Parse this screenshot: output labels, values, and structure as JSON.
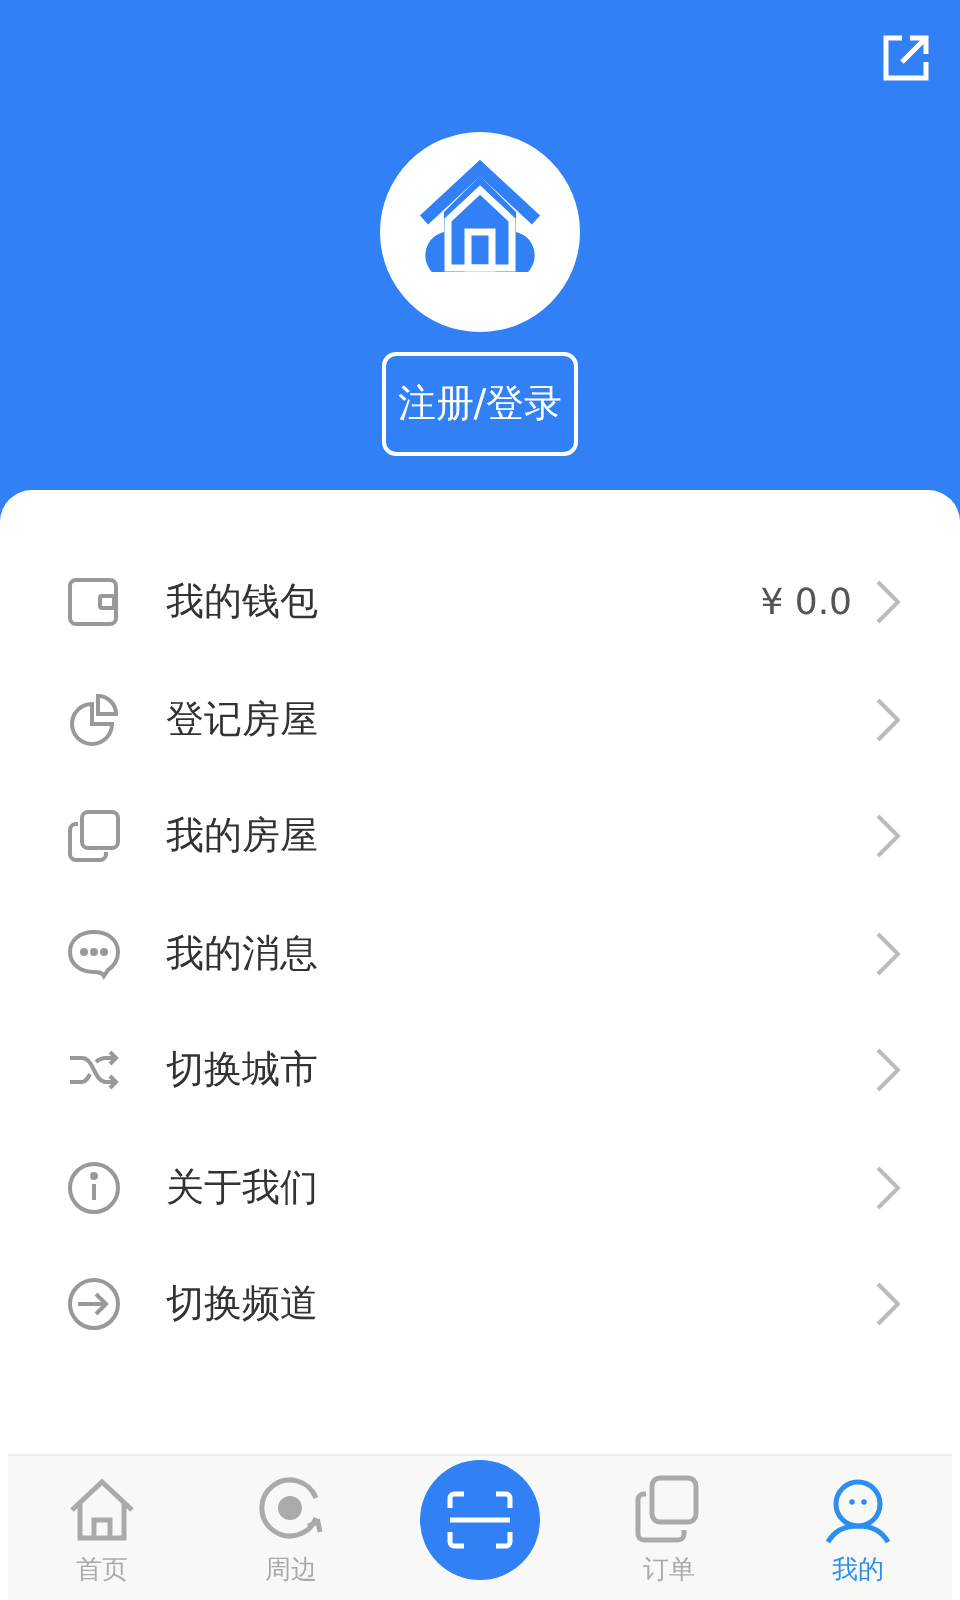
{
  "header": {
    "login_button": "注册/登录"
  },
  "menu": [
    {
      "kind": "wallet",
      "label": "我的钱包",
      "value": "¥ 0.0"
    },
    {
      "kind": "pie",
      "label": "登记房屋"
    },
    {
      "kind": "copy",
      "label": "我的房屋"
    },
    {
      "kind": "chat",
      "label": "我的消息"
    },
    {
      "kind": "shuffle",
      "label": "切换城市"
    },
    {
      "kind": "info",
      "label": "关于我们"
    },
    {
      "kind": "enter",
      "label": "切换频道"
    }
  ],
  "tabs": [
    {
      "kind": "home",
      "label": "首页",
      "selected": false
    },
    {
      "kind": "nearby",
      "label": "周边",
      "selected": false
    },
    {
      "kind": "scan"
    },
    {
      "kind": "orders",
      "label": "订单",
      "selected": false
    },
    {
      "kind": "me",
      "label": "我的",
      "selected": true
    }
  ]
}
